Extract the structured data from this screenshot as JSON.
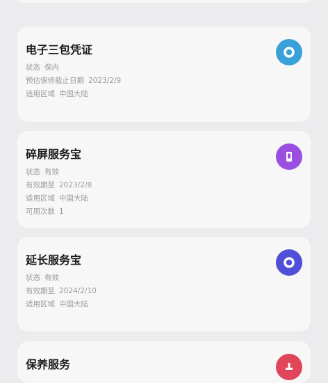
{
  "cards": [
    {
      "title": "电子三包凭证",
      "icon": "ring-icon",
      "icon_color": "#3aa0d8",
      "rows": [
        {
          "label": "状态",
          "value": "保内"
        },
        {
          "label": "预估保修截止日期",
          "value": "2023/2/9"
        },
        {
          "label": "适用区域",
          "value": "中国大陆"
        }
      ]
    },
    {
      "title": "碎屏服务宝",
      "icon": "phone-icon",
      "icon_color": "#9b4fe0",
      "rows": [
        {
          "label": "状态",
          "value": "有效"
        },
        {
          "label": "有效期至",
          "value": "2023/2/8"
        },
        {
          "label": "适用区域",
          "value": "中国大陆"
        },
        {
          "label": "可用次数",
          "value": "1"
        }
      ]
    },
    {
      "title": "延长服务宝",
      "icon": "ring-icon",
      "icon_color": "#4f4fd8",
      "rows": [
        {
          "label": "状态",
          "value": "有效"
        },
        {
          "label": "有效期至",
          "value": "2024/2/10"
        },
        {
          "label": "适用区域",
          "value": "中国大陆"
        }
      ]
    },
    {
      "title": "保养服务",
      "icon": "maintenance-icon",
      "icon_color": "#e0455a",
      "rows": []
    }
  ]
}
